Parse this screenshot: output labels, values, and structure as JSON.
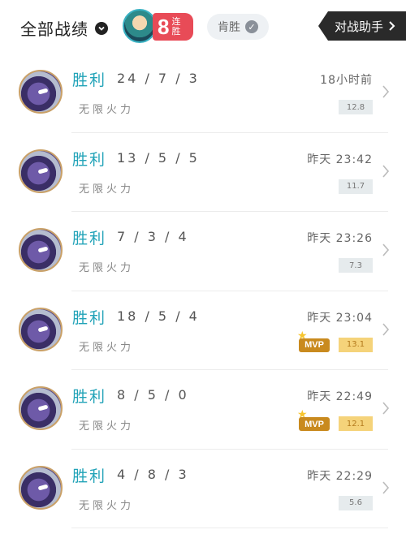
{
  "header": {
    "title": "全部战绩",
    "streak_count": "8",
    "streak_label": "连胜",
    "filter_label": "肯胜",
    "assist_label": "对战助手"
  },
  "matches": [
    {
      "result": "胜利",
      "kda": "24 / 7 / 3",
      "mode": "无限火力",
      "time": "18小时前",
      "score": "12.8",
      "mvp": false
    },
    {
      "result": "胜利",
      "kda": "13 / 5 / 5",
      "mode": "无限火力",
      "time": "昨天 23:42",
      "score": "11.7",
      "mvp": false
    },
    {
      "result": "胜利",
      "kda": "7 / 3 / 4",
      "mode": "无限火力",
      "time": "昨天 23:26",
      "score": "7.3",
      "mvp": false
    },
    {
      "result": "胜利",
      "kda": "18 / 5 / 4",
      "mode": "无限火力",
      "time": "昨天 23:04",
      "score": "13.1",
      "mvp": true,
      "mvp_label": "MVP"
    },
    {
      "result": "胜利",
      "kda": "8 / 5 / 0",
      "mode": "无限火力",
      "time": "昨天 22:49",
      "score": "12.1",
      "mvp": true,
      "mvp_label": "MVP"
    },
    {
      "result": "胜利",
      "kda": "4 / 8 / 3",
      "mode": "无限火力",
      "time": "昨天 22:29",
      "score": "5.6",
      "mvp": false
    }
  ],
  "colors": {
    "accent": "#22a3b8",
    "streak_red": "#e84b57",
    "mvp_gold": "#c98a1e",
    "mvp_score_bg": "#f5d37a"
  }
}
